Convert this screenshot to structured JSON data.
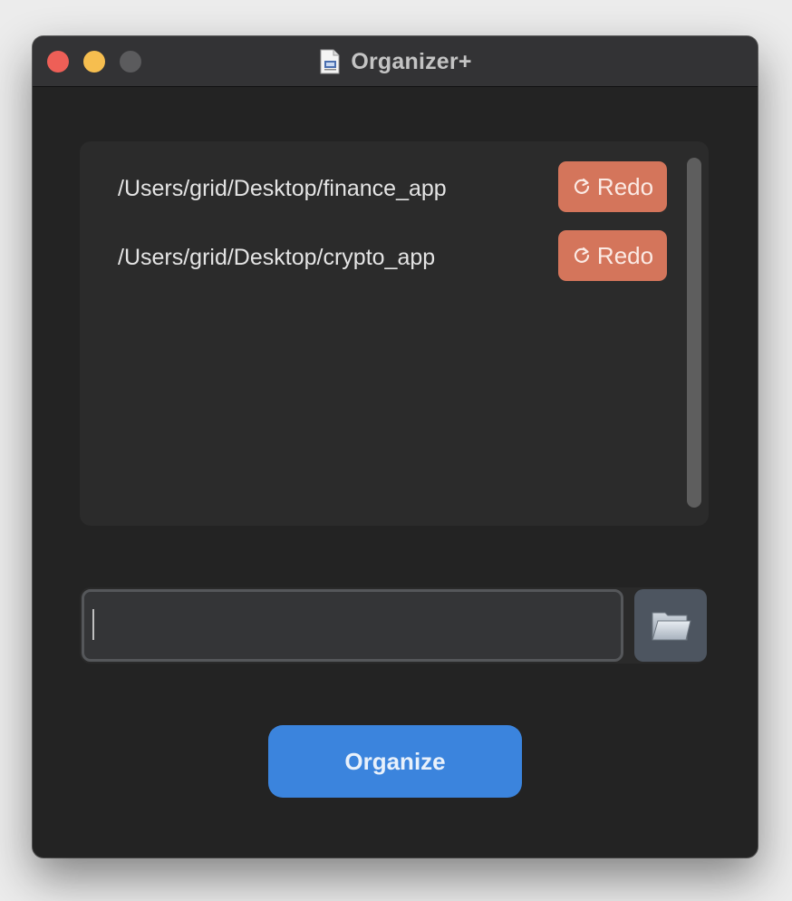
{
  "window": {
    "title": "Organizer+",
    "title_icon": "document-icon"
  },
  "traffic_lights": {
    "close_color": "#ee5f57",
    "minimize_color": "#f6be4f",
    "zoom_color": "#5b5b5d"
  },
  "paths": {
    "items": [
      {
        "path": "/Users/grid/Desktop/finance_app",
        "action_label": "Redo",
        "action_icon": "redo-icon"
      },
      {
        "path": "/Users/grid/Desktop/crypto_app",
        "action_label": "Redo",
        "action_icon": "redo-icon"
      }
    ]
  },
  "input": {
    "value": "",
    "placeholder": "",
    "browse_icon": "folder-icon"
  },
  "actions": {
    "organize_label": "Organize"
  },
  "colors": {
    "accent": "#3b84dd",
    "redo": "#d4755b",
    "window_bg": "#232323",
    "panel_bg": "#2b2b2b"
  }
}
